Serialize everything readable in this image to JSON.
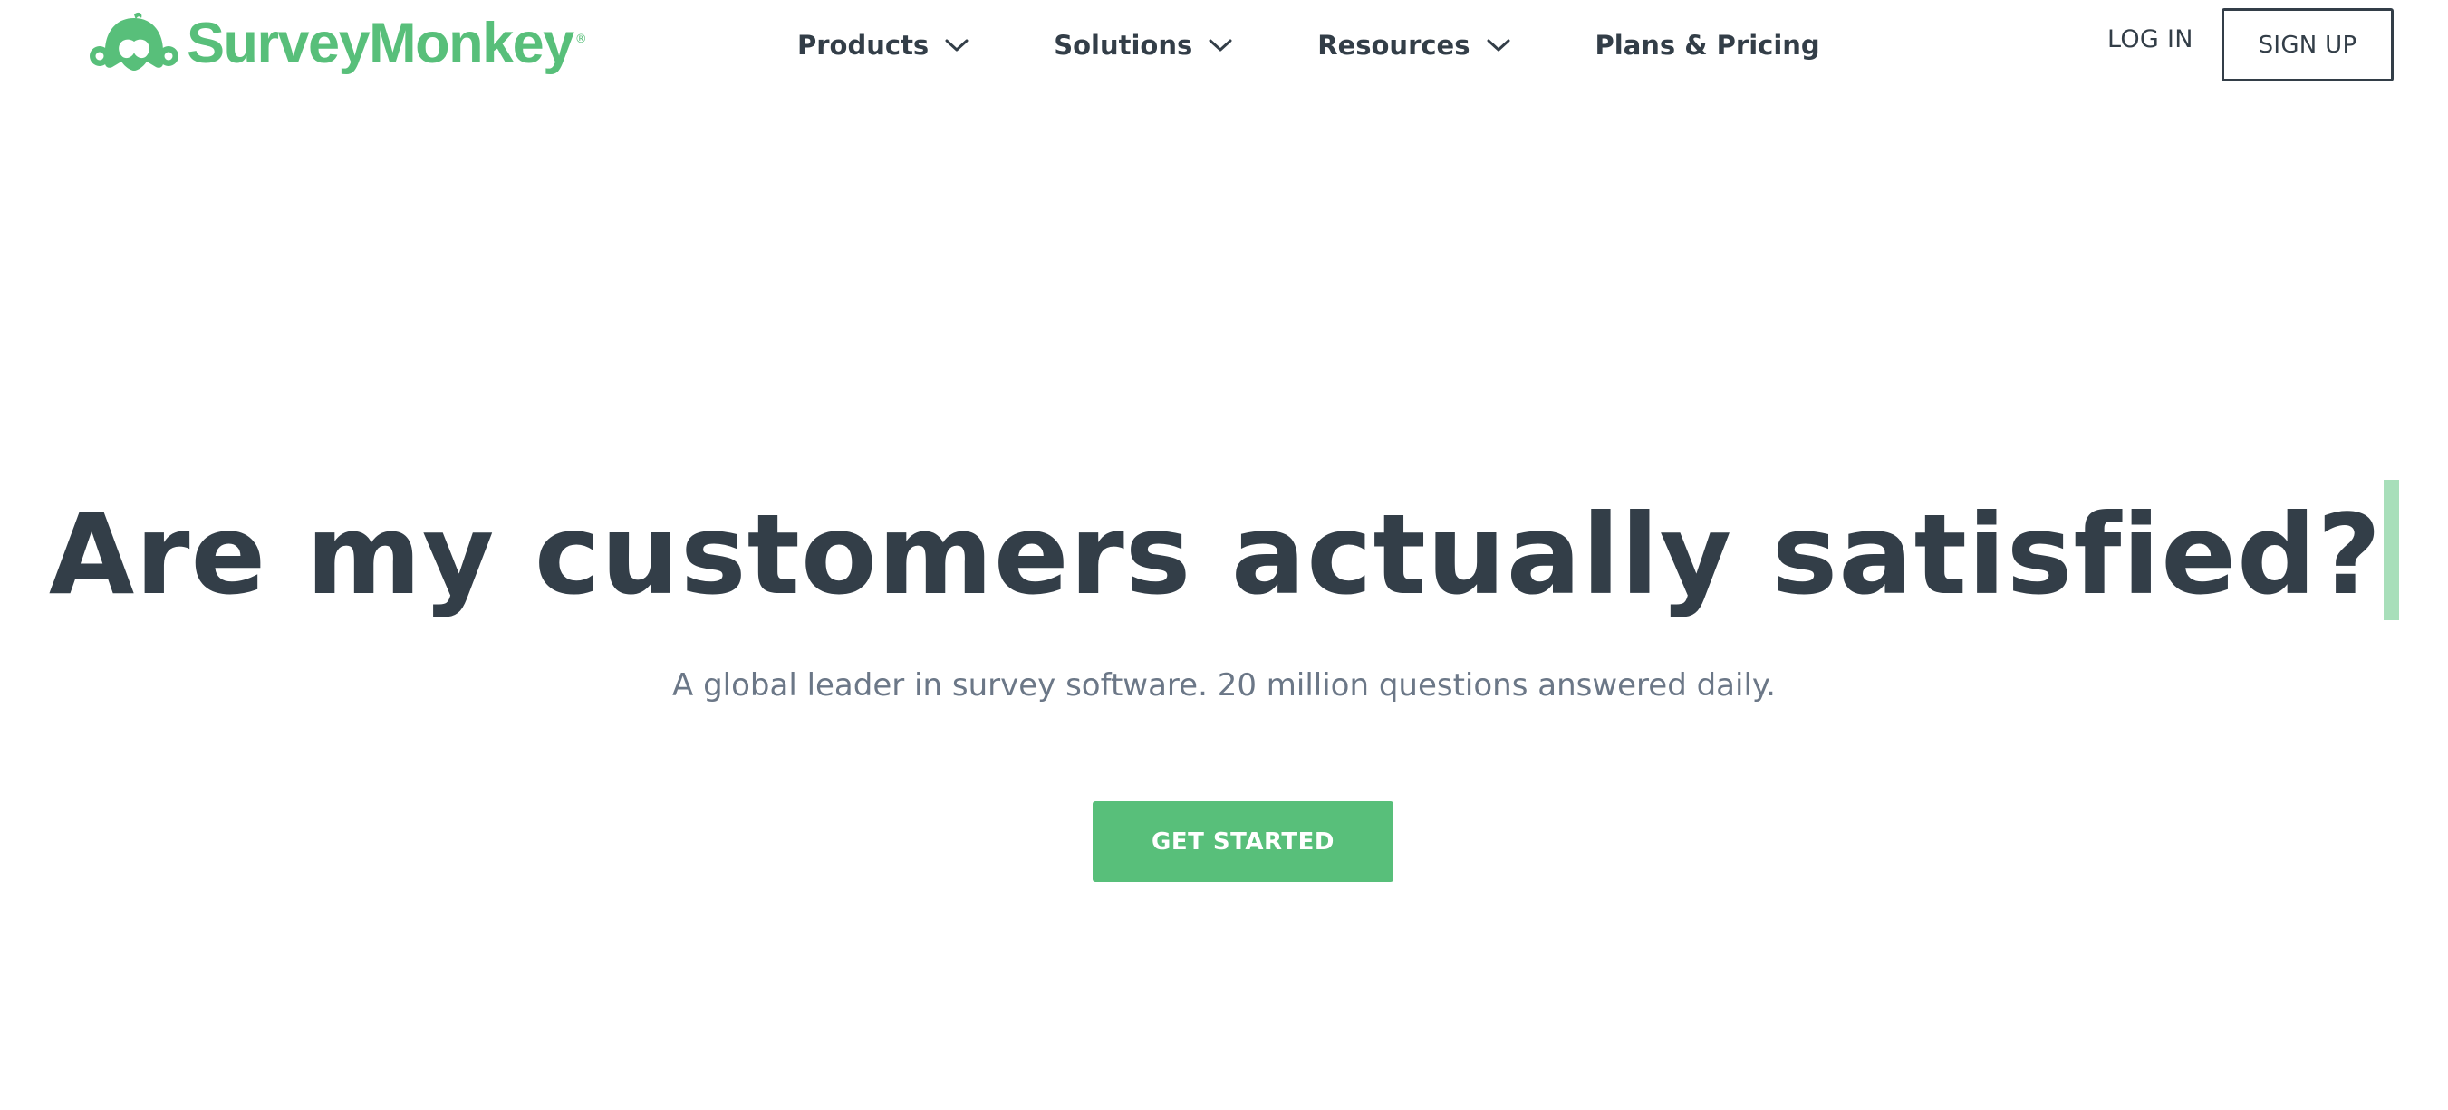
{
  "header": {
    "logo": {
      "text": "SurveyMonkey",
      "registered": "®",
      "icon": "surveymonkey-logo-icon",
      "color": "#58bf7a"
    },
    "nav": [
      {
        "label": "Products",
        "has_dropdown": true,
        "icon": "chevron-down-icon"
      },
      {
        "label": "Solutions",
        "has_dropdown": true,
        "icon": "chevron-down-icon"
      },
      {
        "label": "Resources",
        "has_dropdown": true,
        "icon": "chevron-down-icon"
      },
      {
        "label": "Plans & Pricing",
        "has_dropdown": false
      }
    ],
    "login_label": "LOG IN",
    "signup_label": "SIGN UP"
  },
  "hero": {
    "title": "Are my customers actually satisfied?",
    "subtitle": "A global leader in survey software. 20 million questions answered daily.",
    "cta_label": "GET STARTED"
  },
  "colors": {
    "brand_green": "#58bf7a",
    "text_dark": "#333e48",
    "text_muted": "#6b7787",
    "caret": "#a8dfba",
    "background": "#ffffff"
  }
}
